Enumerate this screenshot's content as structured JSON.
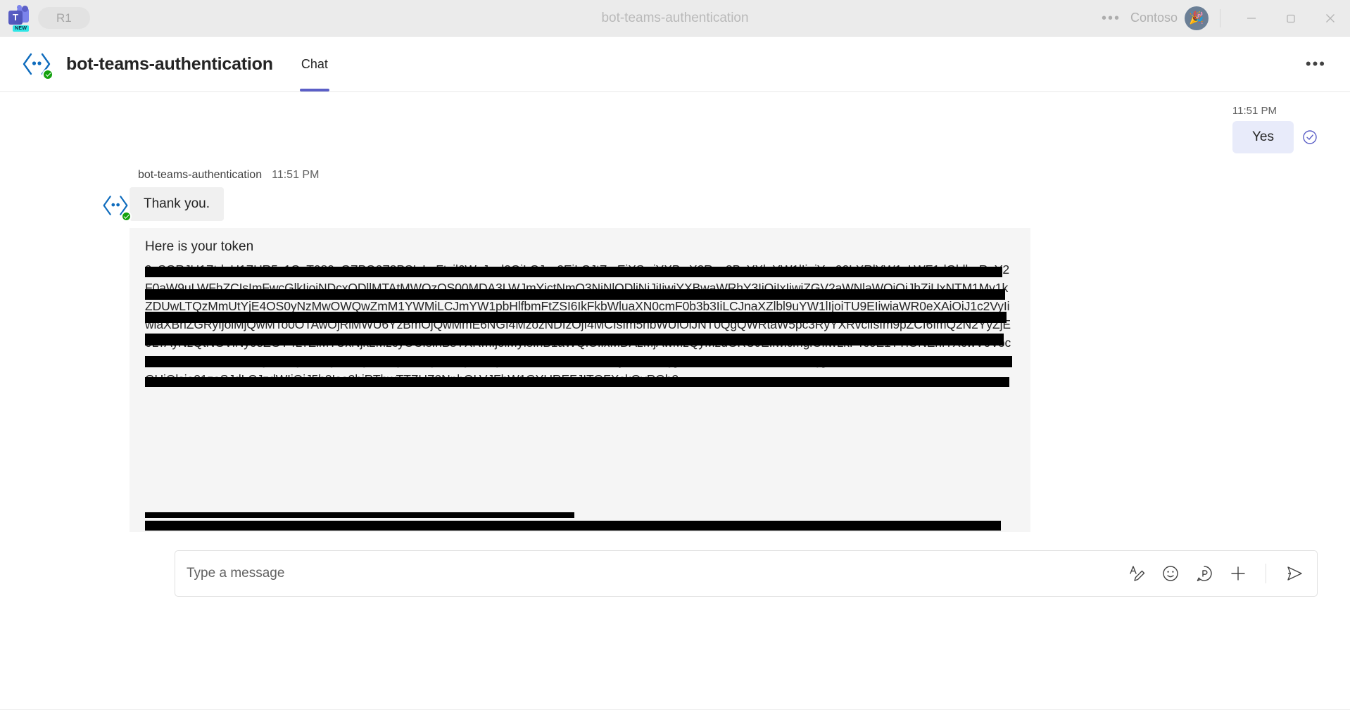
{
  "titlebar": {
    "app_badge": "R1",
    "logo_letter": "T",
    "logo_new_badge": "NEW",
    "window_title": "bot-teams-authentication",
    "more_label": "•••",
    "org_name": "Contoso",
    "avatar_emoji": "🎉",
    "minimize_label": "Minimize",
    "maximize_label": "Restore",
    "close_label": "Close"
  },
  "chat_header": {
    "title": "bot-teams-authentication",
    "tabs": [
      {
        "label": "Chat",
        "active": true
      }
    ],
    "more_label": "•••"
  },
  "messages": {
    "outgoing": {
      "time": "11:51 PM",
      "text": "Yes",
      "status_icon": "seen-check-icon"
    },
    "incoming": {
      "sender": "bot-teams-authentication",
      "time": "11:51 PM",
      "text": "Thank you.",
      "card": {
        "heading": "Here is your token",
        "token_lines": [
          "9xSGRJU1ZtdnU1ZHR5c1QvT080aGZPQ2Z3PSIsImFtcil6WyJwd2QiLCJyc2EiLCJtZmEiXSwiYXBwX2Rpc3BsYXluYW1lIjoiYm90LXRl",
          "YW1zLWF1dGhlbnRpY2F0aW9uLWFhZCIsImFwcGlkIjoiNDcxODllMTAtMWQzOS00MDA3LWJmYjctNmQ3NjNlODliNjJjIiwiYXBwa",
          "WRhY3IiOiIxIiwiZGV2aWNlaWQiOiJhZjUxNTM1My1kZDUwLTQzMmUtYjE4OS0yNzMwOWQwZmM1YWMiLCJmYW1pbHlfbmFt",
          "ZSI6IkFkbWluaXN0cmF0b3b3IiLCJnaXZlbl9uYW1lIjoiTU9EIiwiaWR0eXAiOiJ1c2VyIiwiaXBhZGRyIjoiMjQwMTo0OTAwOjRlMWU6YzB",
          "mOjQwMmE6NGI4MzozNDIzOjI4MCIsIm5hbWUiOiJNT0QgQWRtaW5pc3RyYXRvciIsIm9pZCI6ImQ2N2YyZjE0LTAyNzQtNGViNy",
          "05ZGY4LTZiMTUxNjk2MzcyOCIsInBsYXRmIjoiMyIsInB1aWQiOiIxMDAzMjAwMzQyMzdGRUJEIiwicmgiOiIwLkFTc0E1TTlONEhfTX",
          "cwV0VocUFZeU9xdXJnTUFBQUFBQUFBQXdBQUFBQUFBQUFFQ0FPQC4iLCJzY3AiOiJVc2VyLlJlYWQgcHJvZmlsZSBvcGVuaWQgZ",
          "W1haWwiLCJzaWduaW5fc3RhdGUiOlsia21zaSJdLCJzdWIiOiJ5b3Isa3hiRThwTTZUZ2NnhOLVJFbW1GYUREFJITGFXckQyRGh2"
        ]
      }
    }
  },
  "composer": {
    "placeholder": "Type a message",
    "value": "",
    "icons": [
      {
        "name": "format-text-icon",
        "label": "Format"
      },
      {
        "name": "emoji-icon",
        "label": "Emoji"
      },
      {
        "name": "sticker-icon",
        "label": "Sticker"
      },
      {
        "name": "attach-icon",
        "label": "Attach"
      },
      {
        "name": "send-icon",
        "label": "Send"
      }
    ]
  },
  "colors": {
    "accent": "#5b5fc7",
    "outgoing_bubble": "#e8ebfa",
    "incoming_bubble": "#f0f0f0",
    "card_bg": "#f5f5f5",
    "verified_green": "#13a10e",
    "titlebar_bg": "#ebebeb"
  }
}
